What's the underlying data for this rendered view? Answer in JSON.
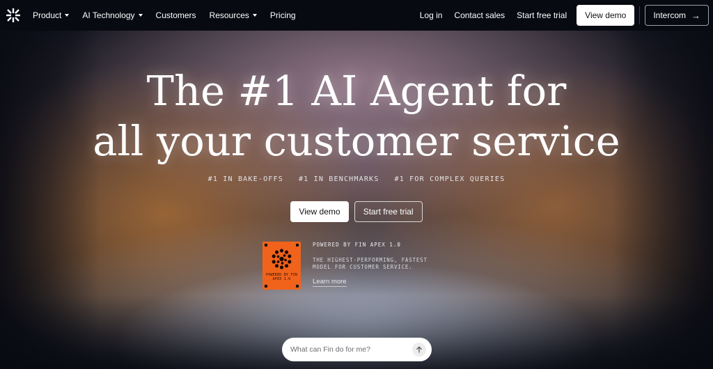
{
  "nav": {
    "menu": [
      {
        "label": "Product",
        "has_dropdown": true
      },
      {
        "label": "AI Technology",
        "has_dropdown": true
      },
      {
        "label": "Customers",
        "has_dropdown": false
      },
      {
        "label": "Resources",
        "has_dropdown": true
      },
      {
        "label": "Pricing",
        "has_dropdown": false
      }
    ],
    "login": "Log in",
    "contact_sales": "Contact sales",
    "start_trial": "Start free trial",
    "view_demo": "View demo",
    "intercom": "Intercom"
  },
  "hero": {
    "title_line1": "The #1 AI Agent for",
    "title_line2": "all your customer service",
    "badges": [
      "#1 IN BAKE-OFFS",
      "#1 IN BENCHMARKS",
      "#1 FOR COMPLEX QUERIES"
    ],
    "primary_button": "View demo",
    "secondary_button": "Start free trial"
  },
  "apex": {
    "card_text": "POWERED BY FIN APEX 1.0",
    "title": "POWERED BY FIN APEX 1.0",
    "description": "THE HIGHEST-PERFORMING, FASTEST MODEL FOR CUSTOMER SERVICE.",
    "link": "Learn more",
    "card_color": "#f1631b"
  },
  "search": {
    "placeholder": "What can Fin do for me?"
  },
  "icons": {
    "logo": "intercom-logo-icon",
    "send": "arrow-up-icon",
    "intercom_arrow": "arrow-right-icon"
  }
}
